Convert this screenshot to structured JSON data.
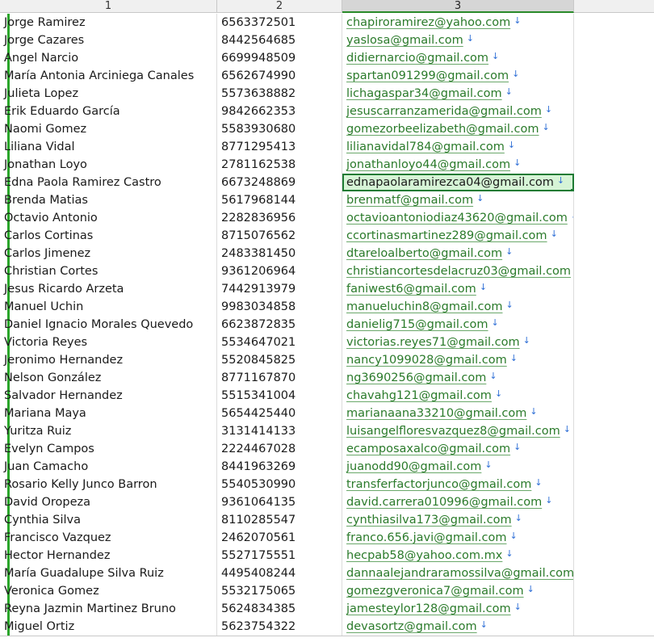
{
  "column_headers": [
    "1",
    "2",
    "3"
  ],
  "selected_column": "3",
  "active_row_index": 9,
  "link_icon": "download-arrow-icon",
  "colors": {
    "accent": "#1e7b34",
    "link": "#2a7a2a",
    "icon": "#2f6fd6",
    "active_fill": "#d6f4d6"
  },
  "rows": [
    {
      "name": "Jorge Ramirez",
      "phone": "6563372501",
      "email": "chapiroramirez@yahoo.com"
    },
    {
      "name": "Jorge Cazares",
      "phone": "8442564685",
      "email": "yaslosa@gmail.com"
    },
    {
      "name": "Angel Narcio",
      "phone": "6699948509",
      "email": "didiernarcio@gmail.com"
    },
    {
      "name": "María Antonia Arciniega Canales",
      "phone": "6562674990",
      "email": "spartan091299@gmail.com"
    },
    {
      "name": "Julieta Lopez",
      "phone": "5573638882",
      "email": "lichagaspar34@gmail.com"
    },
    {
      "name": "Erik Eduardo García",
      "phone": "9842662353",
      "email": "jesuscarranzamerida@gmail.com"
    },
    {
      "name": "Naomi Gomez",
      "phone": "5583930680",
      "email": "gomezorbeelizabeth@gmail.com"
    },
    {
      "name": "Liliana Vidal",
      "phone": "8771295413",
      "email": "lilianavidal784@gmail.com"
    },
    {
      "name": "Jonathan Loyo",
      "phone": "2781162538",
      "email": "jonathanloyo44@gmail.com"
    },
    {
      "name": "Edna Paola Ramirez Castro",
      "phone": "6673248869",
      "email": "ednapaolaramirezca04@gmail.com"
    },
    {
      "name": "Brenda Matias",
      "phone": "5617968144",
      "email": "brenmatf@gmail.com"
    },
    {
      "name": "Octavio Antonio",
      "phone": "2282836956",
      "email": "octavioantoniodiaz43620@gmail.com"
    },
    {
      "name": "Carlos Cortinas",
      "phone": "8715076562",
      "email": "ccortinasmartinez289@gmail.com"
    },
    {
      "name": "Carlos Jimenez",
      "phone": "2483381450",
      "email": "dtareloalberto@gmail.com"
    },
    {
      "name": "Christian Cortes",
      "phone": "9361206964",
      "email": "christiancortesdelacruz03@gmail.com"
    },
    {
      "name": "Jesus Ricardo Arzeta",
      "phone": "7442913979",
      "email": "faniwest6@gmail.com"
    },
    {
      "name": "Manuel Uchin",
      "phone": "9983034858",
      "email": "manueluchin8@gmail.com"
    },
    {
      "name": "Daniel Ignacio Morales Quevedo",
      "phone": "6623872835",
      "email": "danielig715@gmail.com"
    },
    {
      "name": "Victoria Reyes",
      "phone": "5534647021",
      "email": "victorias.reyes71@gmail.com"
    },
    {
      "name": "Jeronimo Hernandez",
      "phone": "5520845825",
      "email": "nancy1099028@gmail.com"
    },
    {
      "name": "Nelson González",
      "phone": "8771167870",
      "email": "ng3690256@gmail.com"
    },
    {
      "name": "Salvador Hernandez",
      "phone": "5515341004",
      "email": "chavahg121@gmail.com"
    },
    {
      "name": "Mariana Maya",
      "phone": "5654425440",
      "email": "marianaana33210@gmail.com"
    },
    {
      "name": "Yuritza Ruiz",
      "phone": "3131414133",
      "email": "luisangelfloresvazquez8@gmail.com"
    },
    {
      "name": "Evelyn Campos",
      "phone": "2224467028",
      "email": "ecamposaxalco@gmail.com"
    },
    {
      "name": "Juan Camacho",
      "phone": "8441963269",
      "email": "juanodd90@gmail.com"
    },
    {
      "name": "Rosario Kelly Junco Barron",
      "phone": "5540530990",
      "email": "transferfactorjunco@gmail.com"
    },
    {
      "name": "David Oropeza",
      "phone": "9361064135",
      "email": "david.carrera010996@gmail.com"
    },
    {
      "name": "Cynthia Silva",
      "phone": "8110285547",
      "email": "cynthiasilva173@gmail.com"
    },
    {
      "name": "Francisco Vazquez",
      "phone": "2462070561",
      "email": "franco.656.javi@gmail.com"
    },
    {
      "name": "Hector Hernandez",
      "phone": "5527175551",
      "email": "hecpab58@yahoo.com.mx"
    },
    {
      "name": "María Guadalupe Silva Ruiz",
      "phone": "4495408244",
      "email": "dannaalejandraramossilva@gmail.com"
    },
    {
      "name": "Veronica Gomez",
      "phone": "5532175065",
      "email": "gomezgveronica7@gmail.com"
    },
    {
      "name": "Reyna Jazmin Martinez Bruno",
      "phone": "5624834385",
      "email": "jamesteylor128@gmail.com"
    },
    {
      "name": "Miguel Ortiz",
      "phone": "5623754322",
      "email": "devasortz@gmail.com"
    }
  ]
}
